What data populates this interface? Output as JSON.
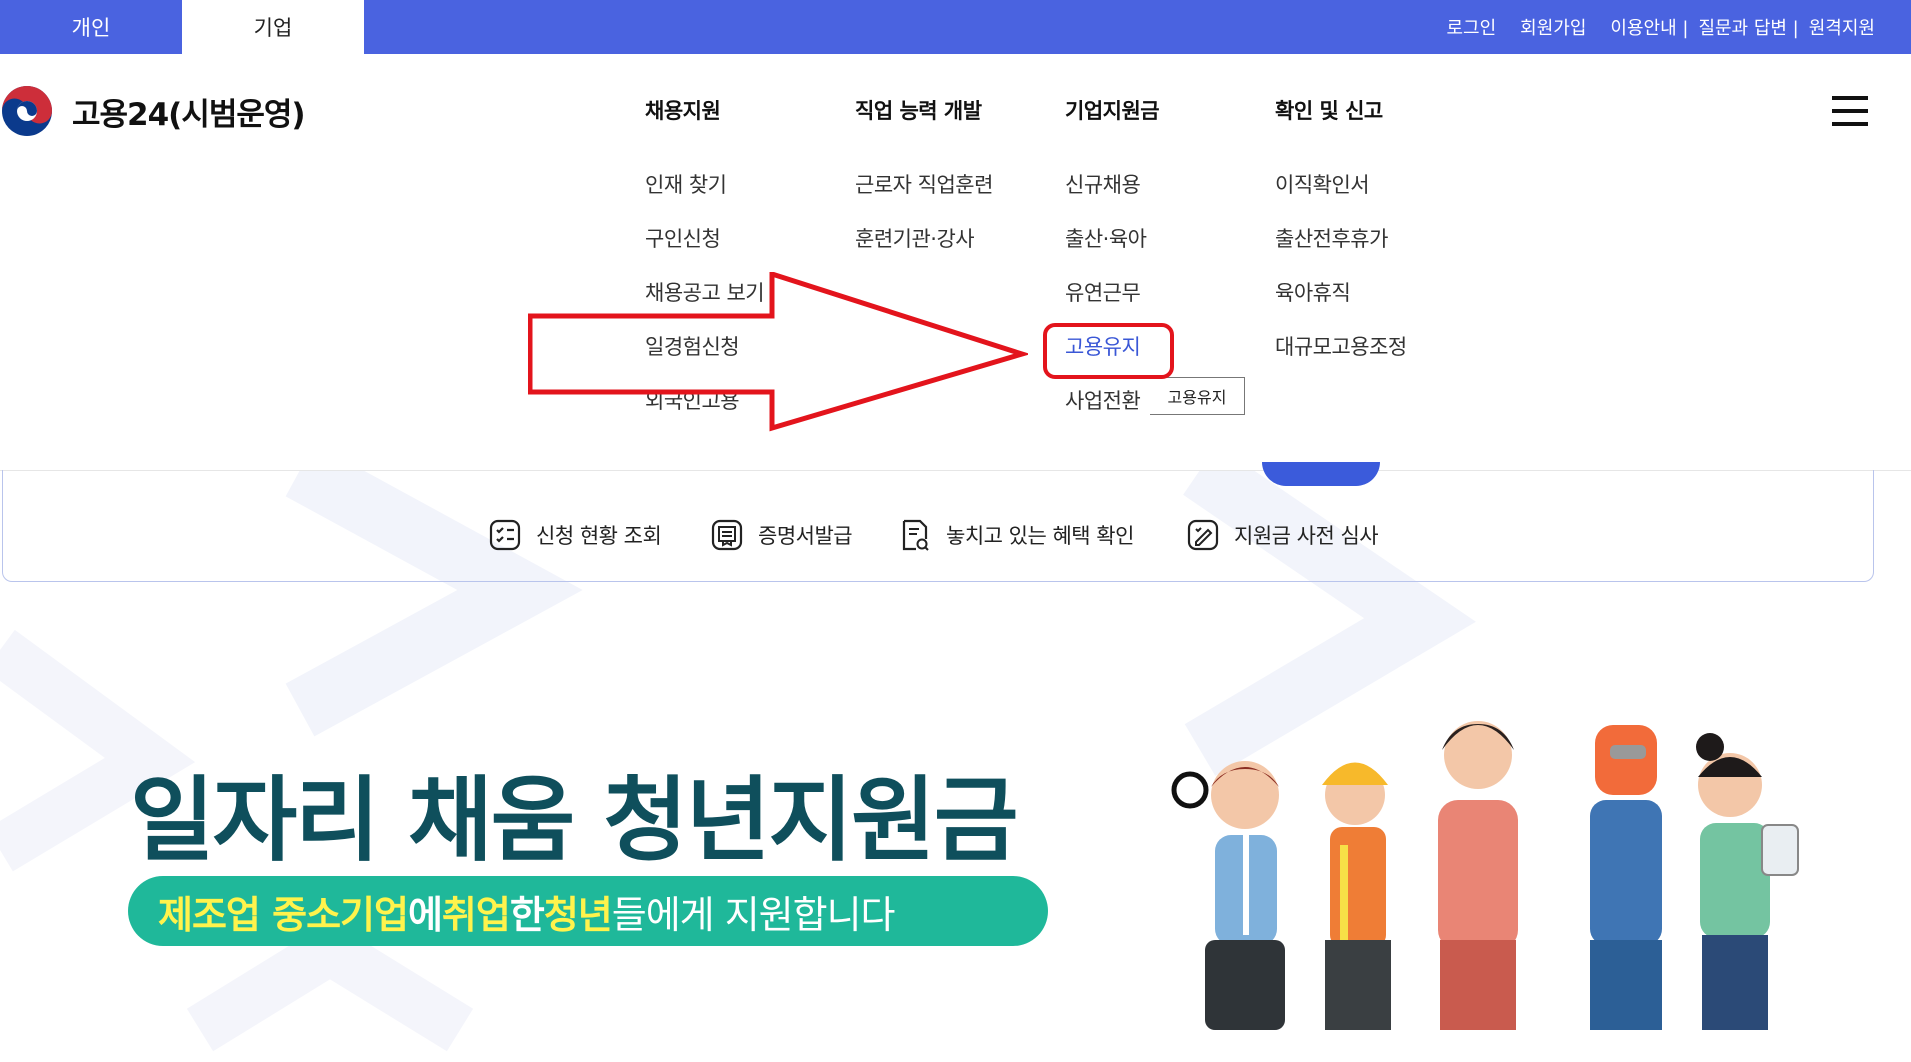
{
  "top_tabs": [
    "개인",
    "기업"
  ],
  "top_links": [
    "로그인",
    "회원가입",
    "이용안내 |",
    "질문과 답변 |",
    "원격지원"
  ],
  "logo": {
    "text": "고용24(시범운영)"
  },
  "menu": [
    {
      "head": "채용지원",
      "items": [
        "인재 찾기",
        "구인신청",
        "채용공고 보기",
        "일경험신청",
        "외국인고용"
      ]
    },
    {
      "head": "직업 능력 개발",
      "items": [
        "근로자 직업훈련",
        "훈련기관·강사"
      ]
    },
    {
      "head": "기업지원금",
      "items": [
        "신규채용",
        "출산·육아",
        "유연근무",
        "고용유지",
        "사업전환"
      ]
    },
    {
      "head": "확인 및 신고",
      "items": [
        "이직확인서",
        "출산전후휴가",
        "육아휴직",
        "대규모고용조정"
      ]
    }
  ],
  "tooltip": "고용유지",
  "quick_services": [
    "신청 현황 조회",
    "증명서발급",
    "놓치고 있는 혜택 확인",
    "지원금 사전 심사"
  ],
  "banner": {
    "title": "일자리 채움 청년지원금",
    "subtitle_parts": [
      {
        "text": "제조업 중소기업",
        "hl": true
      },
      {
        "text": "에 ",
        "hl": false
      },
      {
        "text": "취업",
        "hl": true
      },
      {
        "text": "한 ",
        "hl": false
      },
      {
        "text": "청년",
        "hl": true
      },
      {
        "text": "들에게 지원합니다",
        "hl": false
      }
    ]
  },
  "colors": {
    "topbar": "#4a63e0",
    "active_link": "#3a57d6",
    "banner_title": "#0f4f5c",
    "pill": "#1fb89a",
    "highlight": "#fff34c",
    "annotation_red": "#e3141c"
  }
}
